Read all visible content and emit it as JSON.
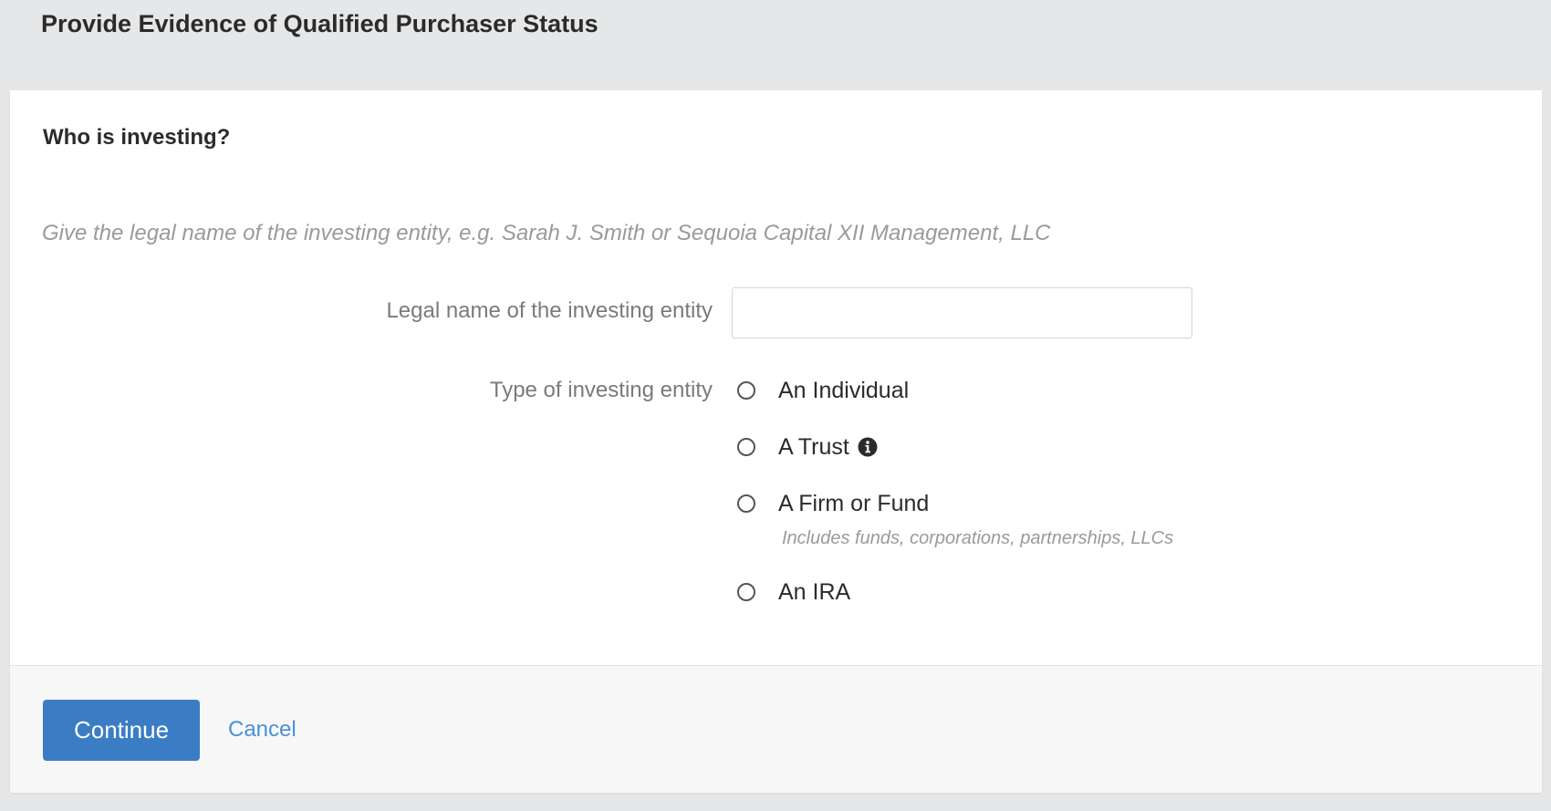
{
  "page": {
    "title": "Provide Evidence of Qualified Purchaser Status"
  },
  "form": {
    "heading": "Who is investing?",
    "hint": "Give the legal name of the investing entity, e.g. Sarah J. Smith or Sequoia Capital XII Management, LLC",
    "legal_name": {
      "label": "Legal name of the investing entity",
      "value": "",
      "placeholder": ""
    },
    "entity_type": {
      "label": "Type of investing entity",
      "options": [
        {
          "label": "An Individual",
          "selected": false
        },
        {
          "label": "A Trust",
          "selected": false,
          "icon": "info-icon"
        },
        {
          "label": "A Firm or Fund",
          "selected": false,
          "sublabel": "Includes funds, corporations, partnerships, LLCs"
        },
        {
          "label": "An IRA",
          "selected": false
        }
      ]
    }
  },
  "footer": {
    "continue_label": "Continue",
    "cancel_label": "Cancel"
  },
  "colors": {
    "page_background": "#e6e7e9",
    "primary_button": "#3b7dc4",
    "link": "#4a90d9",
    "hint_text": "#9a9a9a",
    "label_text": "#7a7a7a"
  }
}
